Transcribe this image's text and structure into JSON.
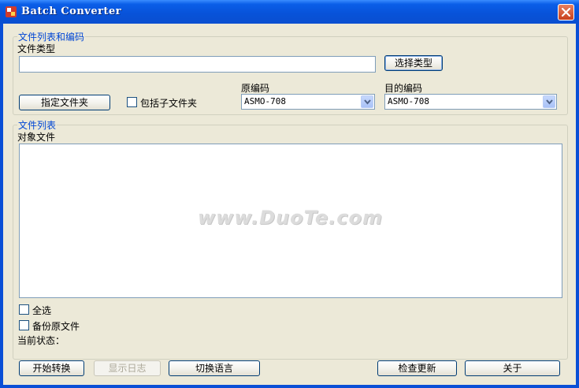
{
  "window": {
    "title": "Batch Converter"
  },
  "encoding_group": {
    "title": "文件列表和编码",
    "file_type_label": "文件类型",
    "file_type_value": "",
    "select_type_button": "选择类型",
    "specify_folder_button": "指定文件夹",
    "include_subfolders_label": "包括子文件夹",
    "include_subfolders_checked": false,
    "source_encoding_label": "原编码",
    "source_encoding_value": "ASMO-708",
    "target_encoding_label": "目的编码",
    "target_encoding_value": "ASMO-708"
  },
  "file_list_group": {
    "title": "文件列表",
    "target_files_label": "对象文件",
    "select_all_label": "全选",
    "select_all_checked": false,
    "backup_label": "备份原文件",
    "backup_checked": false,
    "status_label": "当前状态："
  },
  "watermark": "www.DuoTe.com",
  "buttons": {
    "start_convert": "开始转换",
    "show_log": "显示日志",
    "switch_language": "切换语言",
    "check_update": "检查更新",
    "about": "关于"
  }
}
